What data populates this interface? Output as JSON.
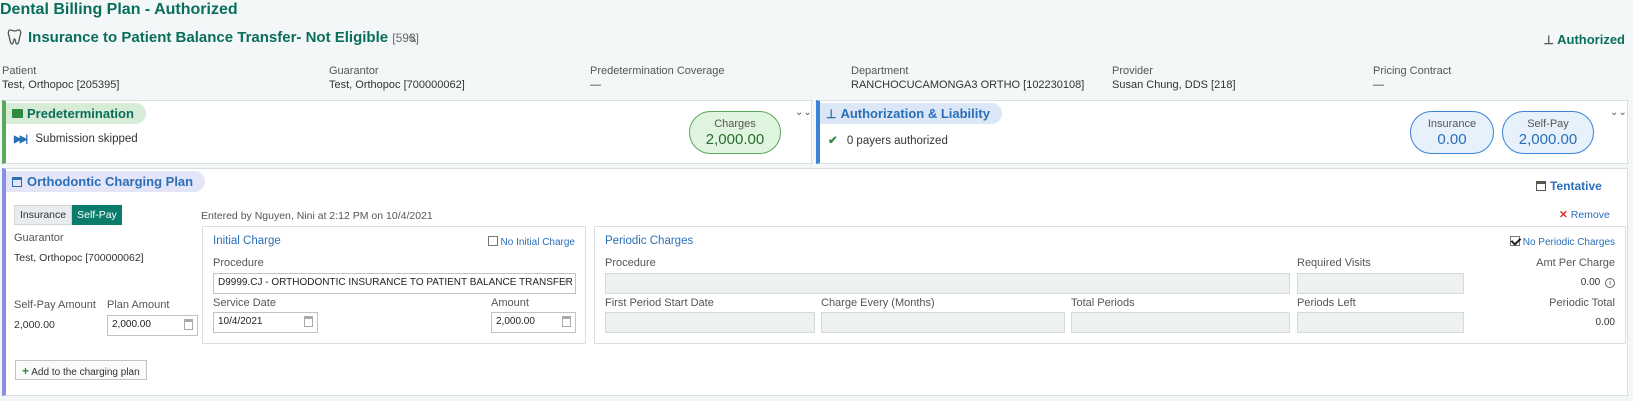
{
  "app_title": "Dental Billing Plan - Authorized",
  "plan": {
    "title": "Insurance to Patient Balance Transfer- Not Eligible",
    "id": "[593]",
    "status": "Authorized"
  },
  "info": [
    {
      "label": "Patient",
      "value": "Test, Orthopoc [205395]"
    },
    {
      "label": "Guarantor",
      "value": "Test, Orthopoc [700000062]"
    },
    {
      "label": "Predetermination Coverage",
      "value": "—"
    },
    {
      "label": "Department",
      "value": "RANCHOCUCAMONGA3 ORTHO [102230108]"
    },
    {
      "label": "Provider",
      "value": "Susan Chung, DDS [218]"
    },
    {
      "label": "Pricing Contract",
      "value": "—"
    }
  ],
  "predetermination": {
    "title": "Predetermination",
    "status": "Submission skipped",
    "charges_label": "Charges",
    "charges_value": "2,000.00"
  },
  "authorization": {
    "title": "Authorization & Liability",
    "status": "0 payers authorized",
    "insurance_label": "Insurance",
    "insurance_value": "0.00",
    "selfpay_label": "Self-Pay",
    "selfpay_value": "2,000.00"
  },
  "ortho": {
    "title": "Orthodontic Charging Plan",
    "status": "Tentative",
    "tab_insurance": "Insurance",
    "tab_selfpay": "Self-Pay",
    "entered_by": "Entered by Nguyen, Nini at 2:12 PM on 10/4/2021",
    "remove": "Remove",
    "guarantor_label": "Guarantor",
    "guarantor_value": "Test, Orthopoc [700000062]",
    "selfpay_amount_label": "Self-Pay Amount",
    "selfpay_amount_value": "2,000.00",
    "plan_amount_label": "Plan Amount",
    "plan_amount_value": "2,000.00",
    "add_button": "Add to the charging plan",
    "initial": {
      "title": "Initial Charge",
      "no_initial_label": "No Initial Charge",
      "procedure_label": "Procedure",
      "procedure_value": "D9999.CJ - ORTHODONTIC INSURANCE TO PATIENT BALANCE TRANSFER",
      "service_date_label": "Service Date",
      "service_date_value": "10/4/2021",
      "amount_label": "Amount",
      "amount_value": "2,000.00"
    },
    "periodic": {
      "title": "Periodic Charges",
      "no_periodic_label": "No Periodic Charges",
      "procedure_label": "Procedure",
      "required_visits_label": "Required Visits",
      "amt_per_charge_label": "Amt Per Charge",
      "amt_per_charge_value": "0.00",
      "first_period_label": "First Period Start Date",
      "charge_every_label": "Charge Every (Months)",
      "total_periods_label": "Total Periods",
      "periods_left_label": "Periods Left",
      "periodic_total_label": "Periodic Total",
      "periodic_total_value": "0.00"
    }
  },
  "colors": {
    "brand_teal": "#0a6e5c",
    "green_bar": "#5aa85a",
    "blue_bar": "#3a83d6",
    "purple_bar": "#8a8fe6"
  }
}
